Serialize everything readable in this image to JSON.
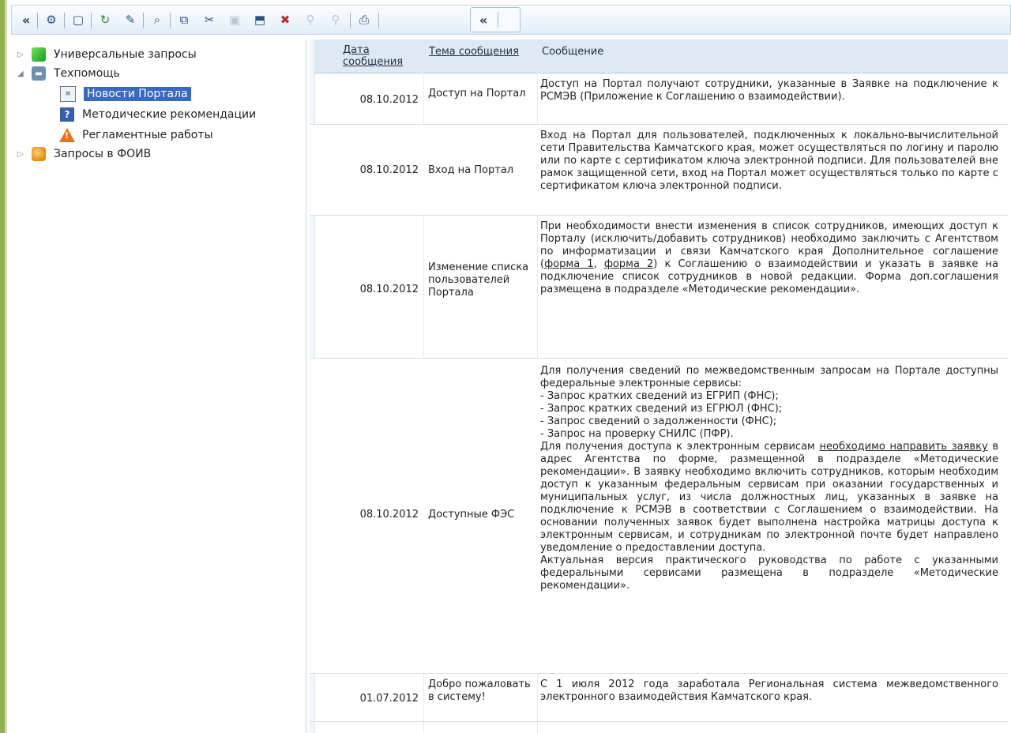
{
  "toolbar": {
    "collapse_left": "«",
    "collapse_right": "«"
  },
  "tree": {
    "items": [
      {
        "label": "Универсальные запросы",
        "icon": "cube-icon"
      },
      {
        "label": "Техпомощь",
        "icon": "truck-icon"
      },
      {
        "label": "Новости Портала",
        "icon": "document-icon",
        "selected": true
      },
      {
        "label": "Методические рекомендации",
        "icon": "help-icon"
      },
      {
        "label": "Регламентные работы",
        "icon": "warning-icon"
      },
      {
        "label": "Запросы в ФОИВ",
        "icon": "globe-icon"
      }
    ]
  },
  "grid": {
    "headers": {
      "date": "Дата сообщения",
      "topic": "Тема сообщения",
      "message": "Сообщение"
    },
    "rows": [
      {
        "date": "08.10.2012",
        "topic": "Доступ на Портал",
        "message": "Доступ на Портал получают сотрудники, указанные в Заявке на подключение к РСМЭВ (Приложение к Соглашению о взаимодействии)."
      },
      {
        "date": "08.10.2012",
        "topic": "Вход на Портал",
        "message": "Вход на Портал для пользователей, подключенных к локально-вычислительной сети Правительства Камчатского края, может осуществляться по логину и паролю или по карте с сертификатом ключа электронной подписи. Для пользователей вне рамок защищенной сети, вход на Портал может осуществляться только по карте с сертификатом ключа электронной подписи."
      },
      {
        "date": "08.10.2012",
        "topic": "Изменение списка пользователей Портала",
        "message_a": "При необходимости внести изменения в список сотрудников, имеющих доступ к Порталу (исключить/добавить сотрудников) необходимо заключить с Агентством по информатизации и связи Камчатского края Дополнительное соглашение (",
        "link1": "форма 1",
        "message_b": ", ",
        "link2": "форма 2",
        "message_c": ") к Соглашению о взаимодействии и указать в заявке на подключение список сотрудников в новой редакции. Форма доп.соглашения размещена в подразделе «Методические рекомендации»."
      },
      {
        "date": "08.10.2012",
        "topic": "Доступные ФЭС",
        "message_a": "Для получения сведений по межведомственным запросам на Портале доступны федеральные электронные сервисы:\n- Запрос кратких сведений из ЕГРИП (ФНС);\n- Запрос кратких сведений из ЕГРЮЛ (ФНС);\n- Запрос сведений о задолженности (ФНС);\n- Запрос на проверку СНИЛС (ПФР).\nДля получения доступа к электронным сервисам ",
        "link1": "необходимо направить заявку",
        "message_b": " в адрес Агентства по форме, размещенной в подразделе «Методические рекомендации». В заявку необходимо включить сотрудников, которым необходим доступ к указанным федеральным сервисам при оказании государственных и муниципальных услуг, из числа должностных лиц, указанных в заявке на подключение к РСМЭВ в соответствии с Соглашением о взаимодействии. На основании полученных заявок будет выполнена настройка матрицы доступа к электронным сервисам, и сотрудникам по электронной почте будет направлено уведомление о предоставлении доступа.\nАктуальная версия практического руководства по работе с указанными федеральными сервисами размещена в подразделе «Методические рекомендации»."
      },
      {
        "date": "01.07.2012",
        "topic": "Добро пожаловать в систему!",
        "message": "С 1 июля 2012 года заработала Региональная система межведомственного электронного взаимодействия Камчатского края."
      }
    ]
  }
}
